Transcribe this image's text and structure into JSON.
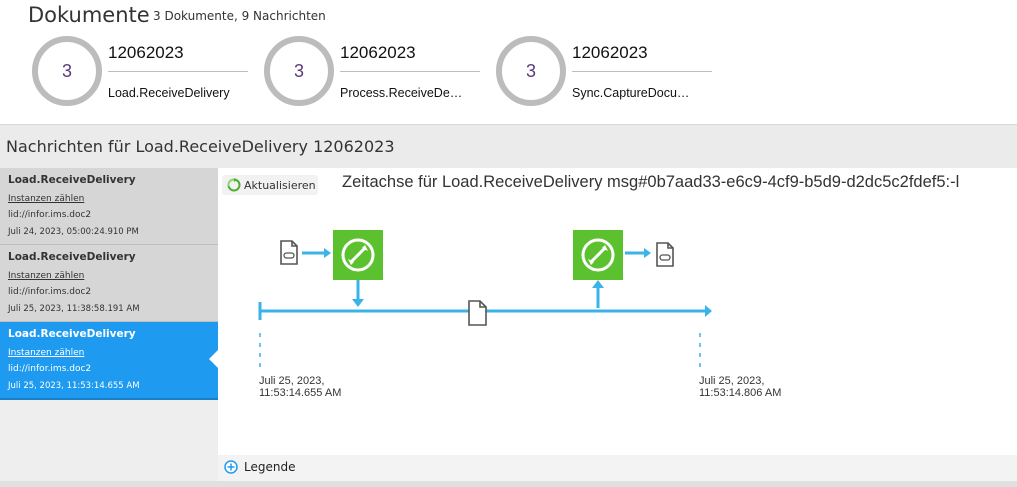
{
  "header": {
    "title": "Dokumente",
    "subtitle": "3 Dokumente, 9 Nachrichten"
  },
  "documents": [
    {
      "count": "3",
      "id": "12062023",
      "name": "Load.ReceiveDelivery"
    },
    {
      "count": "3",
      "id": "12062023",
      "name": "Process.ReceiveDe…"
    },
    {
      "count": "3",
      "id": "12062023",
      "name": "Sync.CaptureDocu…"
    }
  ],
  "section": {
    "title": "Nachrichten für Load.ReceiveDelivery 12062023"
  },
  "messages": [
    {
      "title": "Load.ReceiveDelivery",
      "link": "Instanzen zählen",
      "lid": "lid://infor.ims.doc2",
      "date": "Juli 24, 2023, 05:00:24.910 PM",
      "active": false
    },
    {
      "title": "Load.ReceiveDelivery",
      "link": "Instanzen zählen",
      "lid": "lid://infor.ims.doc2",
      "date": "Juli 25, 2023, 11:38:58.191 AM",
      "active": false
    },
    {
      "title": "Load.ReceiveDelivery",
      "link": "Instanzen zählen",
      "lid": "lid://infor.ims.doc2",
      "date": "Juli 25, 2023, 11:53:14.655 AM",
      "active": true
    }
  ],
  "timeline": {
    "refresh_label": "Aktualisieren",
    "title": "Zeitachse für Load.ReceiveDelivery msg#0b7aad33-e6c9-4cf9-b5d9-d2dc5c2fdef5:-l",
    "start": {
      "date": "Juli 25, 2023,",
      "time": "11:53:14.655 AM"
    },
    "end": {
      "date": "Juli 25, 2023,",
      "time": "11:53:14.806 AM"
    }
  },
  "legend": {
    "label": "Legende"
  },
  "colors": {
    "accent_blue": "#1e9bf0",
    "timeline_blue": "#3ab4e8",
    "node_green": "#5cc12f",
    "count_purple": "#5b3a7a",
    "ring_gray": "#bcbcbc"
  }
}
